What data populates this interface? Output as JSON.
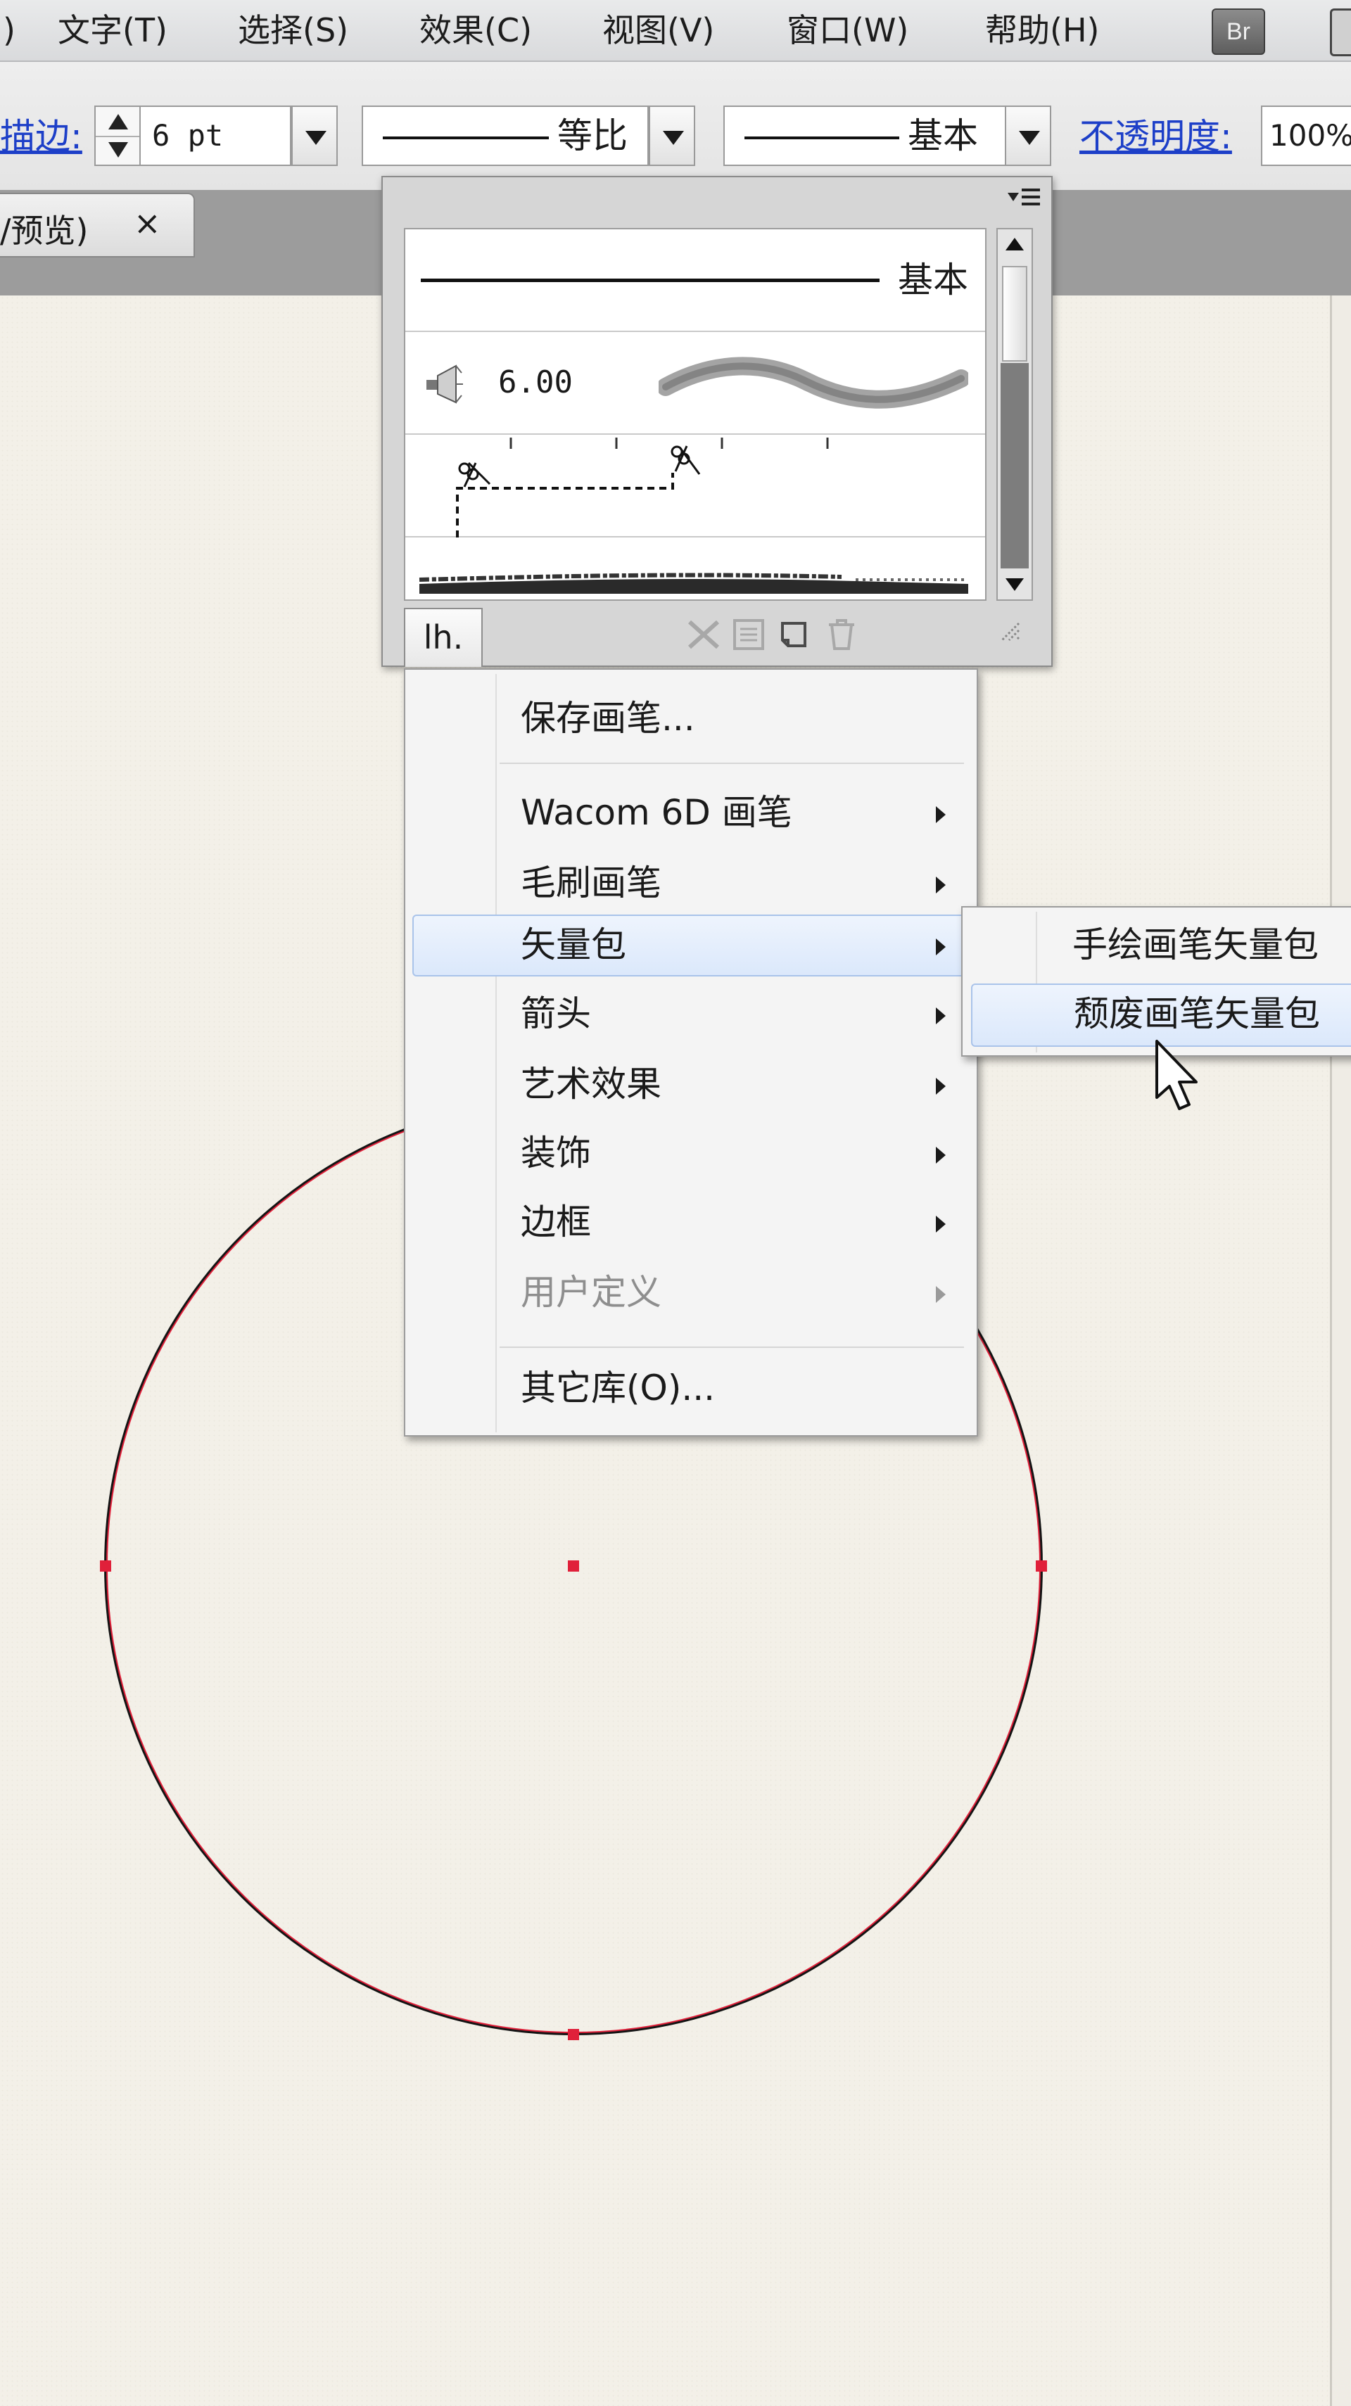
{
  "menubar": {
    "items": [
      {
        "label": ")",
        "name": "menu-prev-fragment"
      },
      {
        "label": "文字(T)",
        "name": "menu-type"
      },
      {
        "label": "选择(S)",
        "name": "menu-select"
      },
      {
        "label": "效果(C)",
        "name": "menu-effect"
      },
      {
        "label": "视图(V)",
        "name": "menu-view"
      },
      {
        "label": "窗口(W)",
        "name": "menu-window"
      },
      {
        "label": "帮助(H)",
        "name": "menu-help"
      }
    ],
    "bridge_label": "Br"
  },
  "control_bar": {
    "stroke_label": "描边:",
    "stroke_weight": "6 pt",
    "profile_label": "等比",
    "brush_label": "基本",
    "opacity_label": "不透明度:",
    "opacity_value": "100%"
  },
  "document_tab": {
    "title": "/预览)",
    "close_glyph": "×"
  },
  "brush_panel": {
    "rows": [
      {
        "label": "基本",
        "kind": "basic-line"
      },
      {
        "label": "6.00",
        "kind": "bristle"
      },
      {
        "label": "",
        "kind": "scissors-pattern"
      },
      {
        "label": "",
        "kind": "charcoal"
      }
    ],
    "lib_button_label": "lh.",
    "footer_icons": [
      "remove-stroke-icon",
      "brush-options-icon",
      "new-brush-icon",
      "delete-brush-icon",
      "resize-grip-icon"
    ]
  },
  "library_menu": {
    "items": [
      {
        "label": "保存画笔...",
        "submenu": false,
        "disabled": false,
        "highlight": false
      },
      {
        "label": "Wacom 6D 画笔",
        "submenu": true,
        "disabled": false,
        "highlight": false
      },
      {
        "label": "毛刷画笔",
        "submenu": true,
        "disabled": false,
        "highlight": false
      },
      {
        "label": "矢量包",
        "submenu": true,
        "disabled": false,
        "highlight": true
      },
      {
        "label": "箭头",
        "submenu": true,
        "disabled": false,
        "highlight": false
      },
      {
        "label": "艺术效果",
        "submenu": true,
        "disabled": false,
        "highlight": false
      },
      {
        "label": "装饰",
        "submenu": true,
        "disabled": false,
        "highlight": false
      },
      {
        "label": "边框",
        "submenu": true,
        "disabled": false,
        "highlight": false
      },
      {
        "label": "用户定义",
        "submenu": true,
        "disabled": true,
        "highlight": false
      },
      {
        "label": "其它库(O)...",
        "submenu": false,
        "disabled": false,
        "highlight": false
      }
    ]
  },
  "vector_pack_submenu": {
    "items": [
      {
        "label": "手绘画笔矢量包",
        "highlight": false
      },
      {
        "label": "颓废画笔矢量包",
        "highlight": true
      }
    ]
  },
  "colors": {
    "selection_red": "#e0203a",
    "stroke_black": "#141414",
    "link_blue": "#1d3fc8",
    "menu_highlight": "#dbe8fb"
  }
}
